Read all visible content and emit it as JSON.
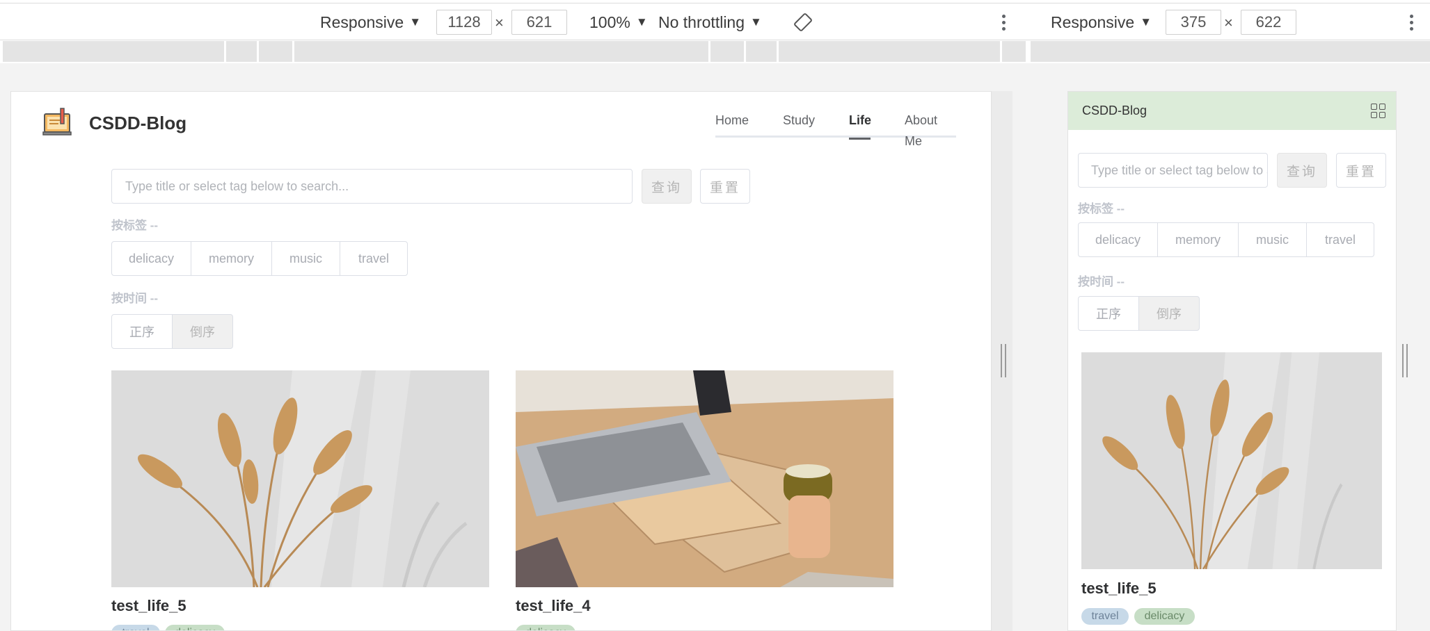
{
  "devtools": {
    "left": {
      "device": "Responsive",
      "width": "1128",
      "height": "621",
      "zoom": "100%",
      "throttling": "No throttling"
    },
    "right": {
      "device": "Responsive",
      "width": "375",
      "height": "622"
    },
    "times": "×",
    "caret": "▼"
  },
  "site": {
    "brand": "CSDD-Blog",
    "nav": [
      {
        "label": "Home",
        "active": false
      },
      {
        "label": "Study",
        "active": false
      },
      {
        "label": "Life",
        "active": true
      },
      {
        "label": "About Me",
        "active": false
      }
    ],
    "search": {
      "placeholder": "Type title or select tag below to search...",
      "mobile_placeholder": "Type title or select tag below to search..."
    },
    "query_button": "查询",
    "reset_button": "重置",
    "tag_label": "按标签 --",
    "time_label": "按时间 --",
    "tags": [
      "delicacy",
      "memory",
      "music",
      "travel"
    ],
    "order": [
      "正序",
      "倒序"
    ],
    "order_selected": "倒序",
    "posts": [
      {
        "title": "test_life_5",
        "image": "dried-pampas-grass",
        "tags": [
          "travel",
          "delicacy"
        ]
      },
      {
        "title": "test_life_4",
        "image": "laptop-on-wooden-stand",
        "tags": [
          "delicacy"
        ]
      }
    ]
  },
  "colors": {
    "accent_green": "#dcecd9",
    "tag_blue": "#c7d9e8",
    "tag_green": "#c7dec6"
  }
}
